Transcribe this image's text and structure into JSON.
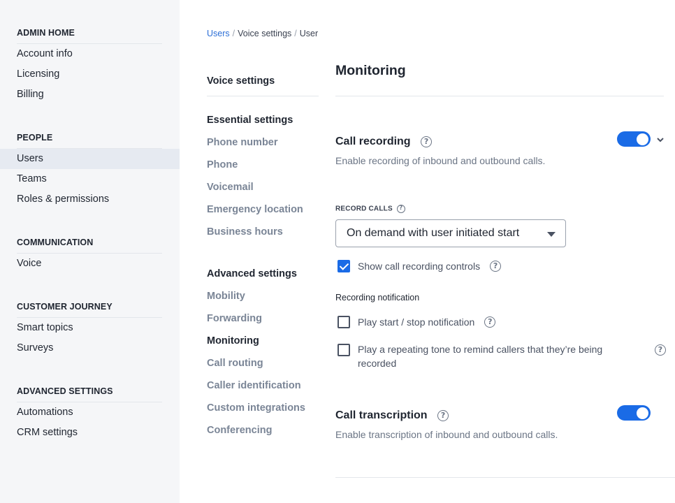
{
  "sidebar": {
    "sections": [
      {
        "title": "ADMIN HOME",
        "items": [
          "Account info",
          "Licensing",
          "Billing"
        ]
      },
      {
        "title": "PEOPLE",
        "items": [
          "Users",
          "Teams",
          "Roles & permissions"
        ]
      },
      {
        "title": "COMMUNICATION",
        "items": [
          "Voice"
        ]
      },
      {
        "title": "CUSTOMER JOURNEY",
        "items": [
          "Smart topics",
          "Surveys"
        ]
      },
      {
        "title": "ADVANCED SETTINGS",
        "items": [
          "Automations",
          "CRM settings"
        ]
      }
    ],
    "active_item": "Users"
  },
  "breadcrumb": {
    "crumb1": "Users",
    "crumb2": "Voice settings",
    "crumb3": "User",
    "separator": "/"
  },
  "settings_nav": {
    "title": "Voice settings",
    "essential_title": "Essential settings",
    "essential_items": [
      "Phone number",
      "Phone",
      "Voicemail",
      "Emergency location",
      "Business hours"
    ],
    "advanced_title": "Advanced settings",
    "advanced_items": [
      "Mobility",
      "Forwarding",
      "Monitoring",
      "Call routing",
      "Caller identification",
      "Custom integrations",
      "Conferencing"
    ],
    "active_item": "Monitoring"
  },
  "main": {
    "title": "Monitoring",
    "call_recording": {
      "heading": "Call recording",
      "description": "Enable recording of inbound and outbound calls.",
      "enabled": true,
      "record_calls_label": "RECORD CALLS",
      "record_calls_value": "On demand with user initiated start",
      "show_controls_label": "Show call recording controls",
      "show_controls_checked": true,
      "notification_label": "Recording notification",
      "play_start_stop_label": "Play start / stop notification",
      "play_start_stop_checked": false,
      "repeating_tone_label": "Play a repeating tone to remind callers that they’re being recorded",
      "repeating_tone_checked": false
    },
    "call_transcription": {
      "heading": "Call transcription",
      "description": "Enable transcription of inbound and outbound calls.",
      "enabled": true
    }
  },
  "icons": {
    "help": "help-circle-icon",
    "chevron": "chevron-down-icon",
    "caret": "caret-down-icon",
    "check": "checkmark-icon"
  },
  "colors": {
    "accent": "#1a6be6",
    "link": "#2b6ed6",
    "sidebar_bg": "#f5f6f8",
    "active_bg": "#e6eaf1"
  }
}
